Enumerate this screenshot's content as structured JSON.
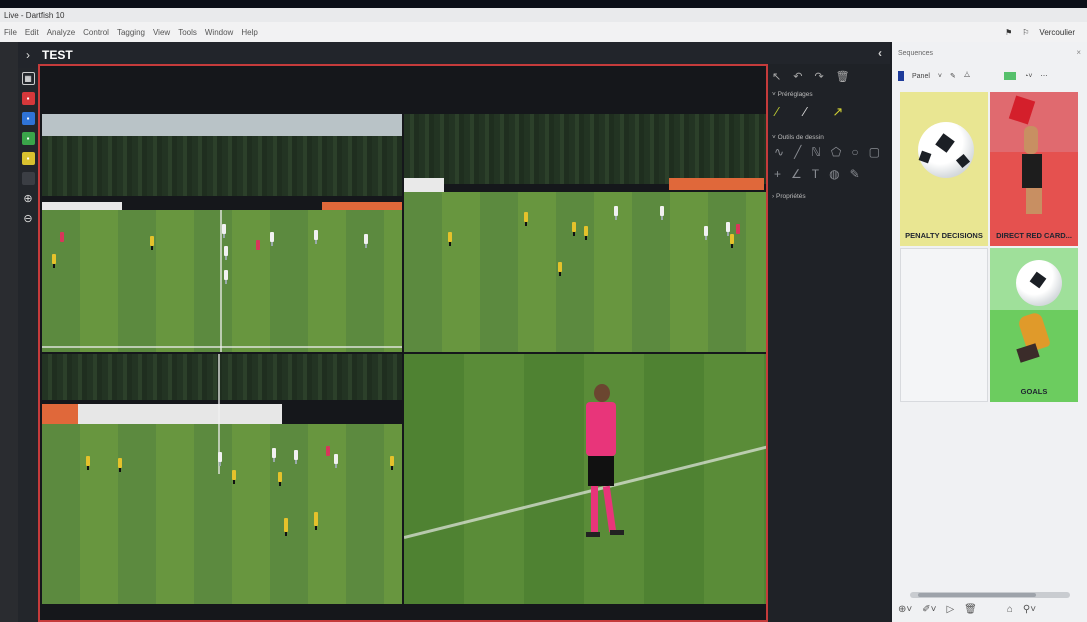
{
  "window": {
    "title": "Live - Dartfish 10"
  },
  "menu": [
    "File",
    "Edit",
    "Analyze",
    "Control",
    "Tagging",
    "View",
    "Tools",
    "Window",
    "Help"
  ],
  "user": {
    "name": "Vercoulier"
  },
  "panel": {
    "title": "TEST"
  },
  "drawing": {
    "sections": [
      "Préréglages",
      "Outils de dessin",
      "Propriétés"
    ]
  },
  "sequences": {
    "title": "Sequences",
    "panel_label": "Panel",
    "cards": [
      {
        "label": "PENALTY DECISIONS",
        "color": "#e9e692"
      },
      {
        "label": "DIRECT RED CARD...",
        "color": "#e06a6f"
      },
      {
        "label": "",
        "color": "#f4f5f7"
      },
      {
        "label": "GOALS",
        "color": "#7fd673"
      }
    ]
  },
  "colors": {
    "accent_red": "#c53b3b",
    "dark_bg": "#1b1e24"
  }
}
